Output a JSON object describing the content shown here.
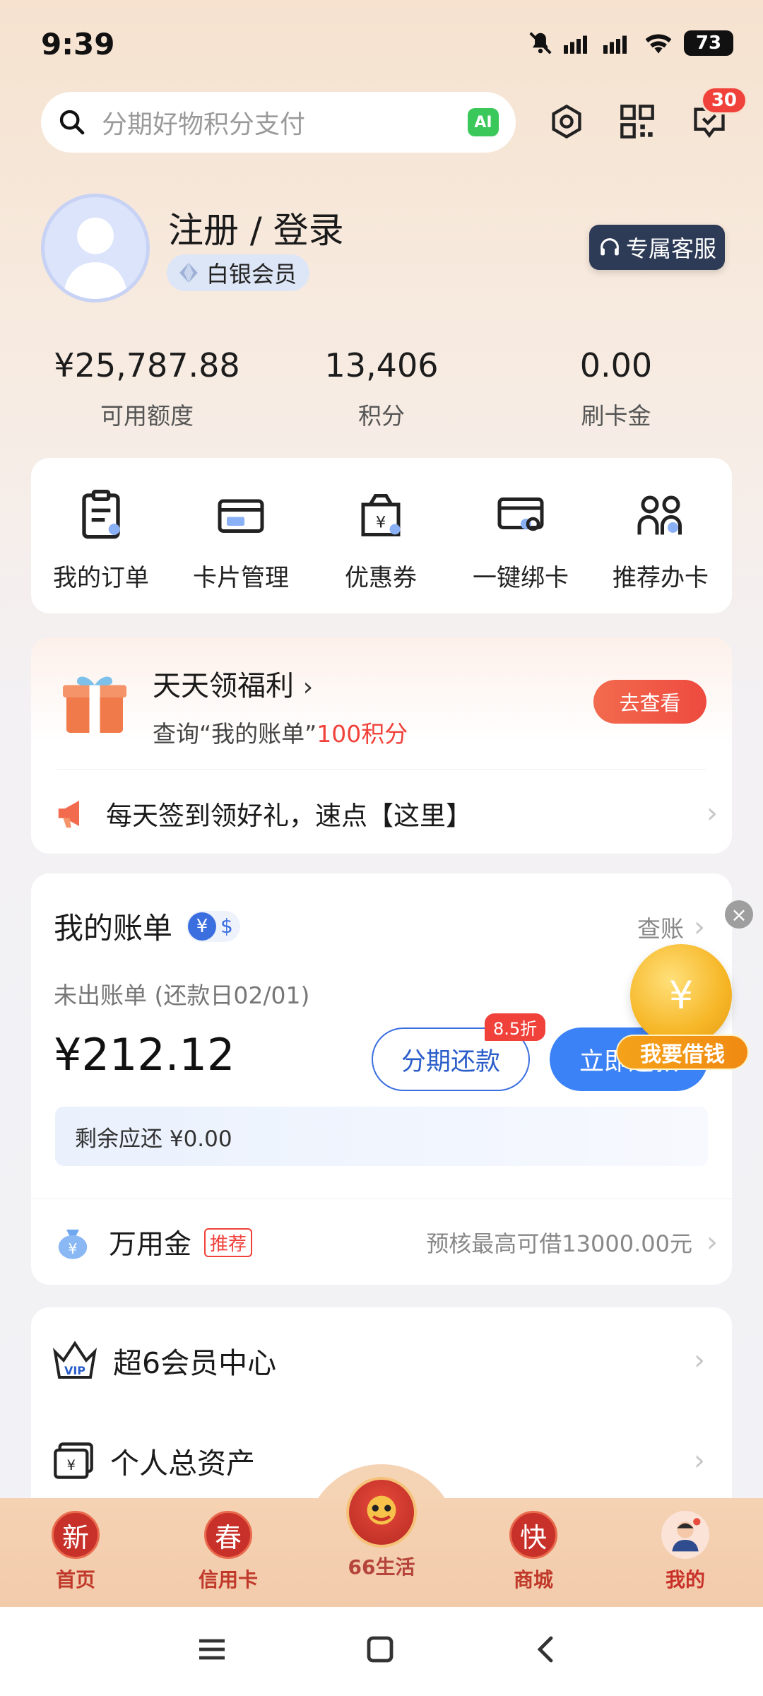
{
  "status_bar": {
    "time": "9:39",
    "battery": "73"
  },
  "search": {
    "placeholder": "分期好物积分支付",
    "ai_label": "AI"
  },
  "header": {
    "message_count": "30"
  },
  "profile": {
    "name": "注册 / 登录",
    "member_level": "白银会员",
    "service_button": "专属客服"
  },
  "stats": [
    {
      "value": "¥25,787.88",
      "label": "可用额度"
    },
    {
      "value": "13,406",
      "label": "积分"
    },
    {
      "value": "0.00",
      "label": "刷卡金"
    }
  ],
  "shortcuts": [
    {
      "label": "我的订单",
      "icon": "order-icon"
    },
    {
      "label": "卡片管理",
      "icon": "card-icon"
    },
    {
      "label": "优惠券",
      "icon": "coupon-icon"
    },
    {
      "label": "一键绑卡",
      "icon": "bind-card-icon"
    },
    {
      "label": "推荐办卡",
      "icon": "recommend-icon"
    }
  ],
  "benefits": {
    "title": "天天领福利",
    "subtitle_prefix": "查询“我的账单”",
    "subtitle_highlight": "100积分",
    "button": "去查看",
    "notice": "每天签到领好礼，速点【这里】"
  },
  "bill": {
    "title": "我的账单",
    "check_label": "查账",
    "subtitle": "未出账单 (还款日02/01)",
    "amount": "¥212.12",
    "installment_button": "分期还款",
    "discount_tag": "8.5折",
    "pay_now_button": "立即还款",
    "remaining": "剩余应还 ¥0.00",
    "loan_float": "我要借钱",
    "wanyongjin": {
      "title": "万用金",
      "tag": "推荐",
      "desc": "预核最高可借13000.00元"
    }
  },
  "menu": [
    {
      "label": "超6会员中心",
      "icon": "vip-crown-icon"
    },
    {
      "label": "个人总资产",
      "icon": "assets-icon"
    }
  ],
  "bottom_nav": [
    {
      "label": "首页",
      "glyph": "新"
    },
    {
      "label": "信用卡",
      "glyph": "春"
    },
    {
      "label": "66生活",
      "glyph": ""
    },
    {
      "label": "商城",
      "glyph": "快"
    },
    {
      "label": "我的",
      "glyph": ""
    }
  ],
  "colors": {
    "accent_red": "#f0413a",
    "accent_blue": "#3b82f6",
    "nav_red": "#c8302a"
  }
}
